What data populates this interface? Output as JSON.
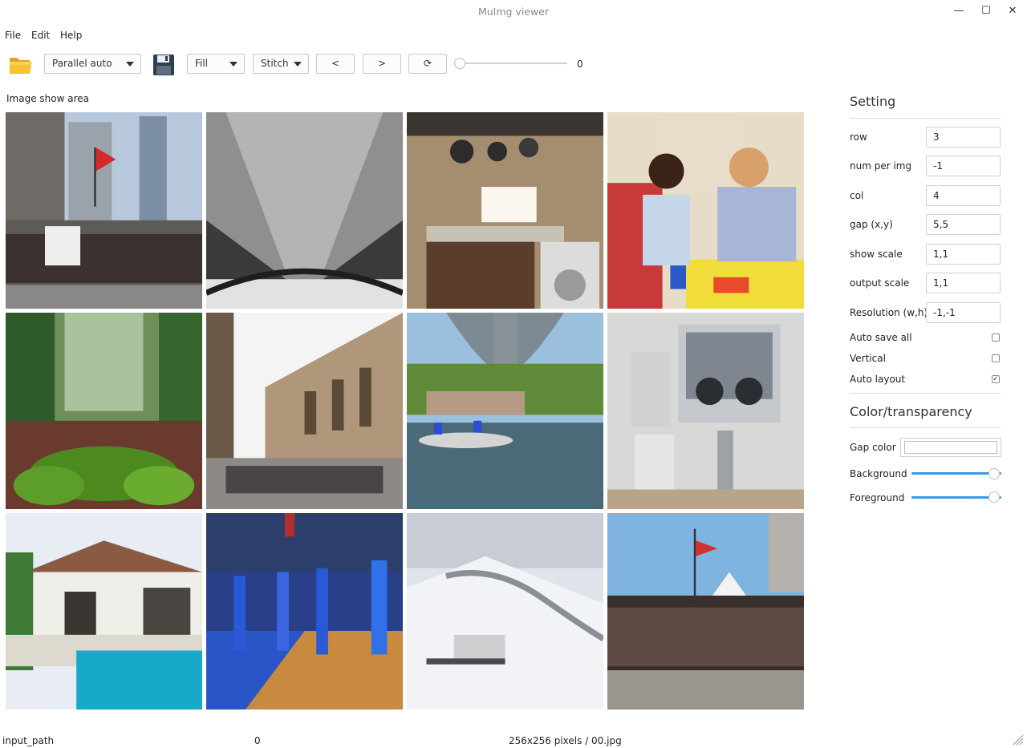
{
  "window": {
    "title": "MuImg viewer",
    "controls": [
      "—",
      "☐",
      "✕"
    ]
  },
  "menu": {
    "items": [
      "File",
      "Edit",
      "Help"
    ]
  },
  "toolbar": {
    "open_icon": "folder-icon",
    "mode_value": "Parallel auto",
    "save_icon": "floppy-disk-icon",
    "fill_value": "Fill",
    "stitch_value": "Stitch",
    "prev_label": "<",
    "next_label": ">",
    "rotate_label": "⟳",
    "slider_value": "0"
  },
  "main": {
    "area_label": "Image show area",
    "images": [
      "street-parade",
      "bridge-underside-bw",
      "kitchen-window",
      "classroom-teacher-child",
      "forest-mossy-rocks",
      "church-plaza-crowd",
      "river-rafting",
      "lab-glovebox",
      "villa-pool",
      "basketball-court-girls",
      "snowy-slope",
      "crowd-event"
    ]
  },
  "sidebar": {
    "setting_title": "Setting",
    "fields": [
      {
        "label": "row",
        "value": "3"
      },
      {
        "label": "num per img",
        "value": "-1"
      },
      {
        "label": "col",
        "value": "4"
      },
      {
        "label": "gap (x,y)",
        "value": "5,5"
      },
      {
        "label": "show scale",
        "value": "1,1"
      },
      {
        "label": "output scale",
        "value": "1,1"
      },
      {
        "label": "Resolution (w,h)",
        "value": "-1,-1"
      }
    ],
    "checks": [
      {
        "label": "Auto save all",
        "checked": false
      },
      {
        "label": "Vertical",
        "checked": false
      },
      {
        "label": "Auto layout",
        "checked": true
      }
    ],
    "color_title": "Color/transparency",
    "gap_color_label": "Gap color",
    "background_label": "Background",
    "foreground_label": "Foreground",
    "background_level": 1.0,
    "foreground_level": 1.0,
    "accent_color": "#3d9ae2"
  },
  "status": {
    "path": "input_path",
    "index": "0",
    "info": "256x256 pixels / 00.jpg"
  }
}
